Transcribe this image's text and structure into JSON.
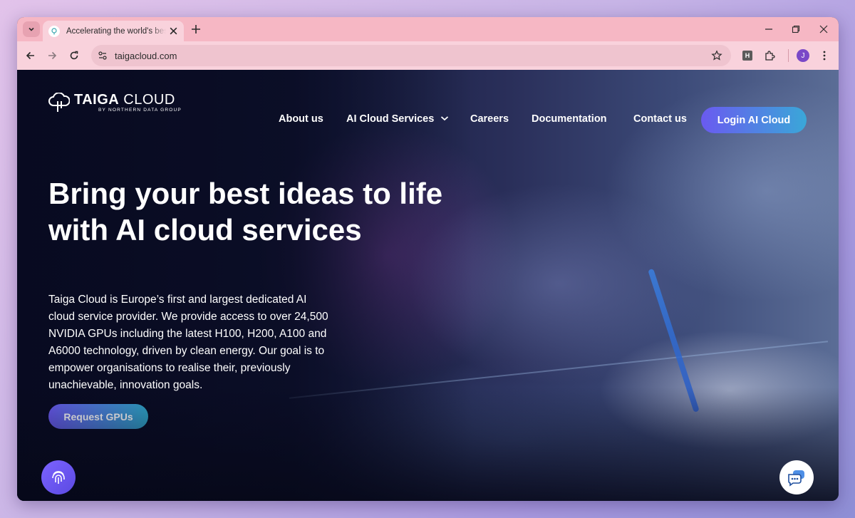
{
  "browser": {
    "tab_title": "Accelerating the world's best ideas",
    "url": "taigacloud.com",
    "avatar_initial": "J",
    "extension_label": "H"
  },
  "site": {
    "logo_name_bold": "TAIGA",
    "logo_name_light": " CLOUD",
    "logo_sub": "BY NORTHERN DATA GROUP",
    "nav": {
      "about": "About us",
      "services": "AI Cloud Services",
      "careers": "Careers",
      "documentation": "Documentation",
      "contact": "Contact us",
      "login": "Login AI Cloud"
    },
    "hero": {
      "headline": "Bring your best ideas to life with AI cloud services",
      "description": "Taiga Cloud is Europe’s first and largest dedicated AI cloud service provider. We provide access to over 24,500 NVIDIA GPUs including the latest H100, H200, A100 and A6000 technology, driven by clean energy. Our goal is to empower organisations to realise their, previously unachievable, innovation goals.",
      "cta": "Request GPUs"
    }
  },
  "colors": {
    "tabstrip": "#f6b7c4",
    "toolbar": "#f9d2dc",
    "accent_start": "#6a5af0",
    "accent_end": "#3aa7d8",
    "page_bg": "#0b0f2a"
  }
}
